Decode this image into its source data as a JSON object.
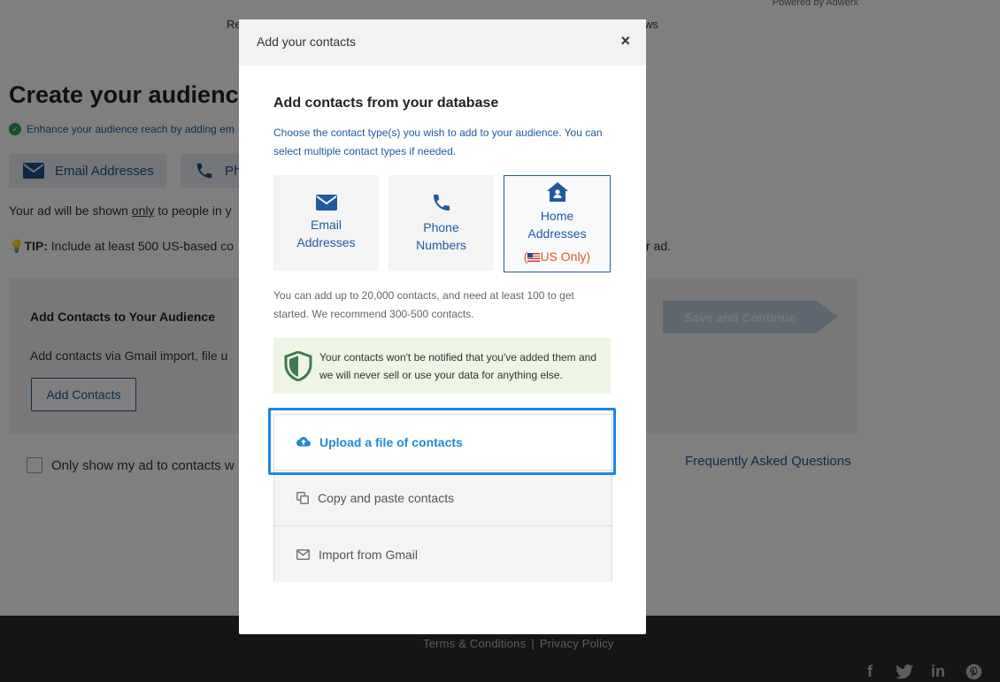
{
  "background": {
    "powered_by": "Powered by Adwerx",
    "nav_left_fragment": "Re",
    "nav_right_fragment": "ws",
    "page_title": "Create your audience",
    "enhance_text": "Enhance your audience reach by adding em",
    "type_buttons": {
      "email": "Email Addresses",
      "phone": "Ph"
    },
    "shown_prefix": "Your ad will be shown ",
    "shown_emphasis": "only",
    "shown_suffix": " to people in y",
    "tip_label": "TIP:",
    "tip_text": " Include at least 500 US-based co",
    "tip_right": "r ad.",
    "panel": {
      "title": "Add Contacts to Your Audience",
      "description": "Add contacts via Gmail import, file u",
      "add_button": "Add Contacts",
      "save_button": "Save and Continue"
    },
    "only_show": "Only show my ad to contacts w",
    "faq": "Frequently Asked Questions",
    "footer": {
      "terms": "Terms & Conditions",
      "separator": "|",
      "privacy": "Privacy Policy"
    },
    "social_icons": [
      "facebook-icon",
      "twitter-icon",
      "linkedin-icon",
      "pinterest-icon"
    ]
  },
  "modal": {
    "title": "Add your contacts",
    "close": "×",
    "heading": "Add contacts from your database",
    "description": "Choose the contact type(s) you wish to add to your audience. You can select multiple contact types if needed.",
    "contact_types": {
      "email_line1": "Email",
      "email_line2": "Addresses",
      "phone_line1": "Phone",
      "phone_line2": "Numbers",
      "home_line1": "Home",
      "home_line2": "Addresses",
      "home_note_open": "(",
      "home_note": "US Only)"
    },
    "limit_text": "You can add up to 20,000 contacts, and need at least 100 to get started. We recommend 300-500 contacts.",
    "privacy_text": "Your contacts won't be notified that you've added them and we will never sell or use your data for anything else.",
    "methods": {
      "upload": "Upload a file of contacts",
      "copy": "Copy and paste contacts",
      "gmail": "Import from Gmail"
    }
  },
  "colors": {
    "brand_blue": "#1f5b9c",
    "link_blue": "#1f8bd1",
    "highlight": "#1b86e6",
    "us_only_orange": "#e2571e",
    "privacy_bg": "#eef5e4"
  }
}
